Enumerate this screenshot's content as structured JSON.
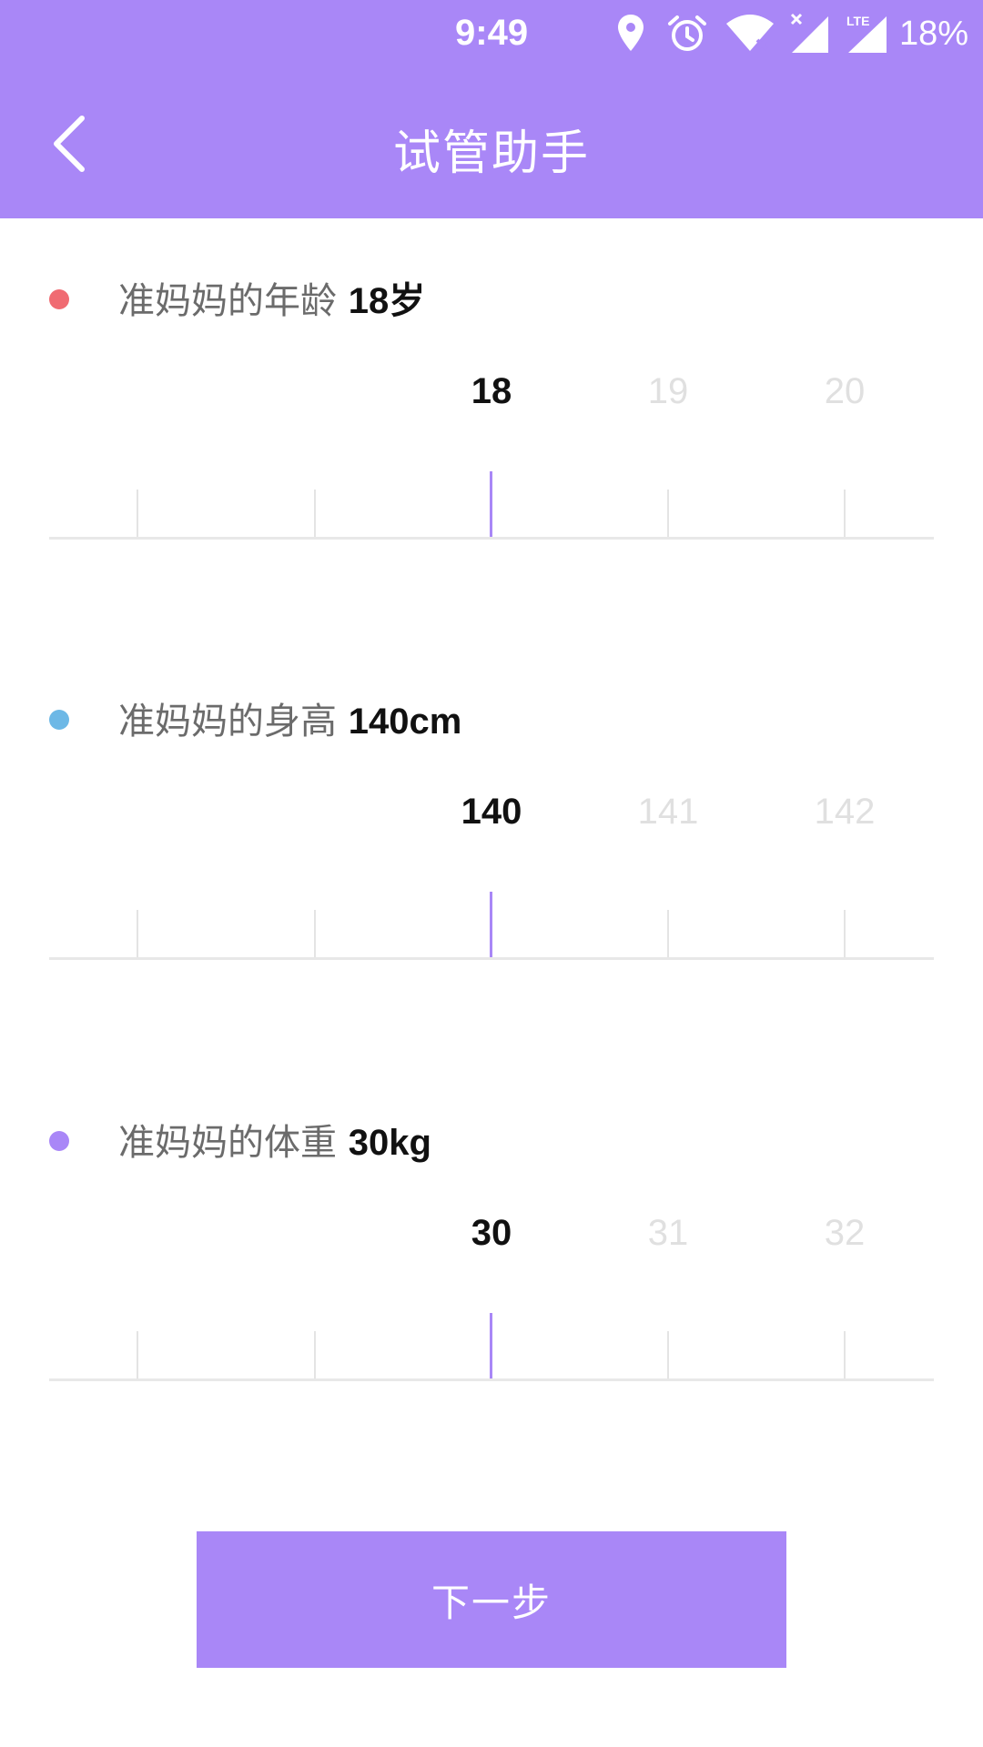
{
  "status_bar": {
    "time": "9:49",
    "battery": "18%",
    "icons": [
      "location-icon",
      "alarm-icon",
      "wifi-icon",
      "signal-lte-icon",
      "signal-icon"
    ]
  },
  "header": {
    "title": "试管助手",
    "back_icon": "chevron-left-icon"
  },
  "colors": {
    "primary": "#a987f7",
    "age_dot": "#f06b72",
    "height_dot": "#6db8e6",
    "weight_dot": "#a987f7"
  },
  "age": {
    "label": "准妈妈的年龄",
    "value": "18岁",
    "ruler": {
      "selected": "18",
      "next": [
        "19",
        "20"
      ]
    }
  },
  "height": {
    "label": "准妈妈的身高",
    "value": "140cm",
    "ruler": {
      "selected": "140",
      "next": [
        "141",
        "142"
      ]
    }
  },
  "weight": {
    "label": "准妈妈的体重",
    "value": "30kg",
    "ruler": {
      "selected": "30",
      "next": [
        "31",
        "32"
      ]
    }
  },
  "next_button": {
    "label": "下一步"
  }
}
